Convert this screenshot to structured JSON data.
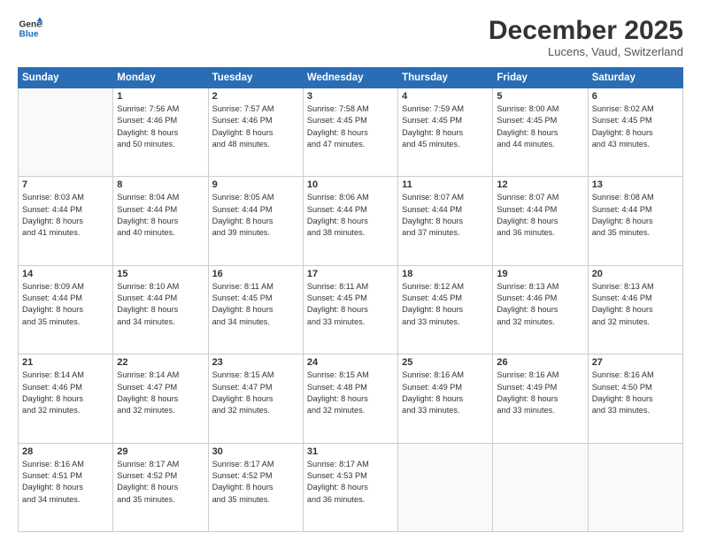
{
  "header": {
    "logo_line1": "General",
    "logo_line2": "Blue",
    "month_title": "December 2025",
    "location": "Lucens, Vaud, Switzerland"
  },
  "weekdays": [
    "Sunday",
    "Monday",
    "Tuesday",
    "Wednesday",
    "Thursday",
    "Friday",
    "Saturday"
  ],
  "weeks": [
    [
      {
        "day": "",
        "lines": []
      },
      {
        "day": "1",
        "lines": [
          "Sunrise: 7:56 AM",
          "Sunset: 4:46 PM",
          "Daylight: 8 hours",
          "and 50 minutes."
        ]
      },
      {
        "day": "2",
        "lines": [
          "Sunrise: 7:57 AM",
          "Sunset: 4:46 PM",
          "Daylight: 8 hours",
          "and 48 minutes."
        ]
      },
      {
        "day": "3",
        "lines": [
          "Sunrise: 7:58 AM",
          "Sunset: 4:45 PM",
          "Daylight: 8 hours",
          "and 47 minutes."
        ]
      },
      {
        "day": "4",
        "lines": [
          "Sunrise: 7:59 AM",
          "Sunset: 4:45 PM",
          "Daylight: 8 hours",
          "and 45 minutes."
        ]
      },
      {
        "day": "5",
        "lines": [
          "Sunrise: 8:00 AM",
          "Sunset: 4:45 PM",
          "Daylight: 8 hours",
          "and 44 minutes."
        ]
      },
      {
        "day": "6",
        "lines": [
          "Sunrise: 8:02 AM",
          "Sunset: 4:45 PM",
          "Daylight: 8 hours",
          "and 43 minutes."
        ]
      }
    ],
    [
      {
        "day": "7",
        "lines": [
          "Sunrise: 8:03 AM",
          "Sunset: 4:44 PM",
          "Daylight: 8 hours",
          "and 41 minutes."
        ]
      },
      {
        "day": "8",
        "lines": [
          "Sunrise: 8:04 AM",
          "Sunset: 4:44 PM",
          "Daylight: 8 hours",
          "and 40 minutes."
        ]
      },
      {
        "day": "9",
        "lines": [
          "Sunrise: 8:05 AM",
          "Sunset: 4:44 PM",
          "Daylight: 8 hours",
          "and 39 minutes."
        ]
      },
      {
        "day": "10",
        "lines": [
          "Sunrise: 8:06 AM",
          "Sunset: 4:44 PM",
          "Daylight: 8 hours",
          "and 38 minutes."
        ]
      },
      {
        "day": "11",
        "lines": [
          "Sunrise: 8:07 AM",
          "Sunset: 4:44 PM",
          "Daylight: 8 hours",
          "and 37 minutes."
        ]
      },
      {
        "day": "12",
        "lines": [
          "Sunrise: 8:07 AM",
          "Sunset: 4:44 PM",
          "Daylight: 8 hours",
          "and 36 minutes."
        ]
      },
      {
        "day": "13",
        "lines": [
          "Sunrise: 8:08 AM",
          "Sunset: 4:44 PM",
          "Daylight: 8 hours",
          "and 35 minutes."
        ]
      }
    ],
    [
      {
        "day": "14",
        "lines": [
          "Sunrise: 8:09 AM",
          "Sunset: 4:44 PM",
          "Daylight: 8 hours",
          "and 35 minutes."
        ]
      },
      {
        "day": "15",
        "lines": [
          "Sunrise: 8:10 AM",
          "Sunset: 4:44 PM",
          "Daylight: 8 hours",
          "and 34 minutes."
        ]
      },
      {
        "day": "16",
        "lines": [
          "Sunrise: 8:11 AM",
          "Sunset: 4:45 PM",
          "Daylight: 8 hours",
          "and 34 minutes."
        ]
      },
      {
        "day": "17",
        "lines": [
          "Sunrise: 8:11 AM",
          "Sunset: 4:45 PM",
          "Daylight: 8 hours",
          "and 33 minutes."
        ]
      },
      {
        "day": "18",
        "lines": [
          "Sunrise: 8:12 AM",
          "Sunset: 4:45 PM",
          "Daylight: 8 hours",
          "and 33 minutes."
        ]
      },
      {
        "day": "19",
        "lines": [
          "Sunrise: 8:13 AM",
          "Sunset: 4:46 PM",
          "Daylight: 8 hours",
          "and 32 minutes."
        ]
      },
      {
        "day": "20",
        "lines": [
          "Sunrise: 8:13 AM",
          "Sunset: 4:46 PM",
          "Daylight: 8 hours",
          "and 32 minutes."
        ]
      }
    ],
    [
      {
        "day": "21",
        "lines": [
          "Sunrise: 8:14 AM",
          "Sunset: 4:46 PM",
          "Daylight: 8 hours",
          "and 32 minutes."
        ]
      },
      {
        "day": "22",
        "lines": [
          "Sunrise: 8:14 AM",
          "Sunset: 4:47 PM",
          "Daylight: 8 hours",
          "and 32 minutes."
        ]
      },
      {
        "day": "23",
        "lines": [
          "Sunrise: 8:15 AM",
          "Sunset: 4:47 PM",
          "Daylight: 8 hours",
          "and 32 minutes."
        ]
      },
      {
        "day": "24",
        "lines": [
          "Sunrise: 8:15 AM",
          "Sunset: 4:48 PM",
          "Daylight: 8 hours",
          "and 32 minutes."
        ]
      },
      {
        "day": "25",
        "lines": [
          "Sunrise: 8:16 AM",
          "Sunset: 4:49 PM",
          "Daylight: 8 hours",
          "and 33 minutes."
        ]
      },
      {
        "day": "26",
        "lines": [
          "Sunrise: 8:16 AM",
          "Sunset: 4:49 PM",
          "Daylight: 8 hours",
          "and 33 minutes."
        ]
      },
      {
        "day": "27",
        "lines": [
          "Sunrise: 8:16 AM",
          "Sunset: 4:50 PM",
          "Daylight: 8 hours",
          "and 33 minutes."
        ]
      }
    ],
    [
      {
        "day": "28",
        "lines": [
          "Sunrise: 8:16 AM",
          "Sunset: 4:51 PM",
          "Daylight: 8 hours",
          "and 34 minutes."
        ]
      },
      {
        "day": "29",
        "lines": [
          "Sunrise: 8:17 AM",
          "Sunset: 4:52 PM",
          "Daylight: 8 hours",
          "and 35 minutes."
        ]
      },
      {
        "day": "30",
        "lines": [
          "Sunrise: 8:17 AM",
          "Sunset: 4:52 PM",
          "Daylight: 8 hours",
          "and 35 minutes."
        ]
      },
      {
        "day": "31",
        "lines": [
          "Sunrise: 8:17 AM",
          "Sunset: 4:53 PM",
          "Daylight: 8 hours",
          "and 36 minutes."
        ]
      },
      {
        "day": "",
        "lines": []
      },
      {
        "day": "",
        "lines": []
      },
      {
        "day": "",
        "lines": []
      }
    ]
  ]
}
